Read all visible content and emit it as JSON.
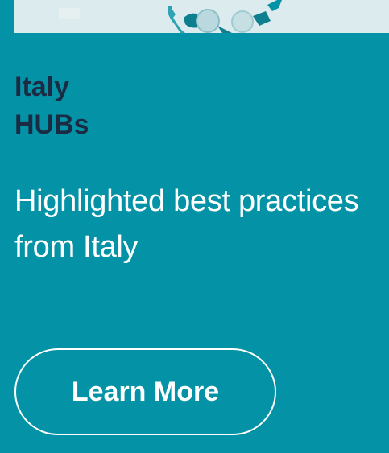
{
  "card": {
    "title_line1": "Italy",
    "title_line2": "HUBs",
    "description": "Highlighted best practices from Italy",
    "cta_label": "Learn More"
  },
  "colors": {
    "background": "#0493a6",
    "title": "#1c2b44",
    "text": "#ffffff",
    "image_background": "#dcebed"
  }
}
